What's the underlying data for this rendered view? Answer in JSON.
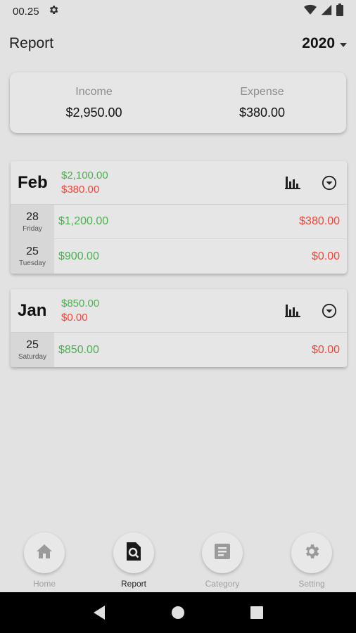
{
  "status_bar": {
    "time": "00.25",
    "icons": [
      "gear-icon",
      "wifi-icon",
      "signal-icon",
      "battery-icon"
    ]
  },
  "header": {
    "title": "Report",
    "year": "2020"
  },
  "summary": {
    "income_label": "Income",
    "income_value": "$2,950.00",
    "expense_label": "Expense",
    "expense_value": "$380.00"
  },
  "months": [
    {
      "name": "Feb",
      "income": "$2,100.00",
      "expense": "$380.00",
      "days": [
        {
          "day": "28",
          "weekday": "Friday",
          "income": "$1,200.00",
          "expense": "$380.00"
        },
        {
          "day": "25",
          "weekday": "Tuesday",
          "income": "$900.00",
          "expense": "$0.00"
        }
      ]
    },
    {
      "name": "Jan",
      "income": "$850.00",
      "expense": "$0.00",
      "days": [
        {
          "day": "25",
          "weekday": "Saturday",
          "income": "$850.00",
          "expense": "$0.00"
        }
      ]
    }
  ],
  "bottom_nav": [
    {
      "label": "Home",
      "icon": "home-icon",
      "active": false
    },
    {
      "label": "Report",
      "icon": "report-search-icon",
      "active": true
    },
    {
      "label": "Category",
      "icon": "category-icon",
      "active": false
    },
    {
      "label": "Setting",
      "icon": "gear-icon",
      "active": false
    }
  ],
  "colors": {
    "income": "#4caf50",
    "expense": "#f44336",
    "background": "#e2e2e2"
  }
}
